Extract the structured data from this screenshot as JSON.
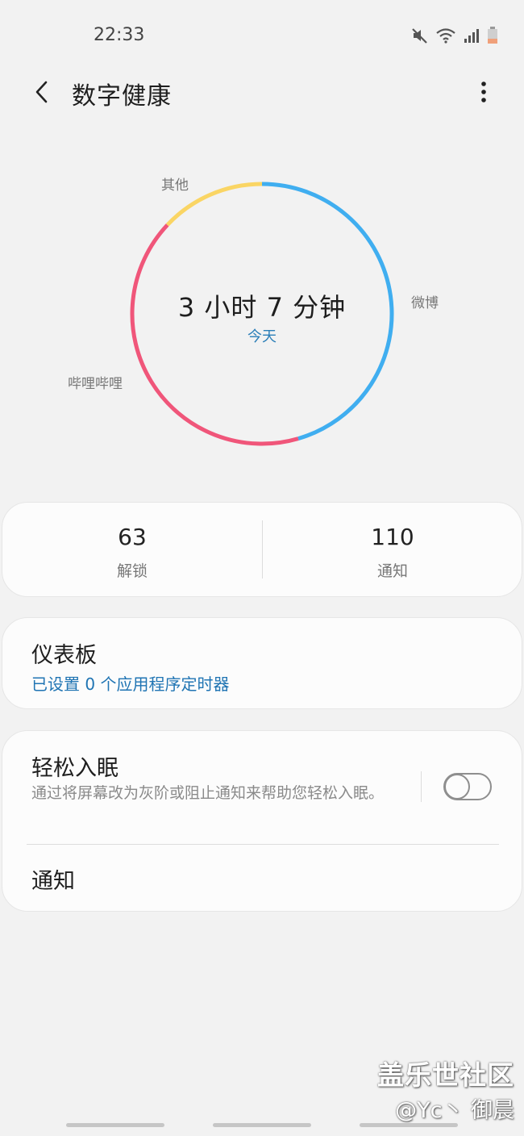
{
  "status_bar": {
    "time": "22:33",
    "icons": [
      "mute-icon",
      "wifi-icon",
      "signal-icon",
      "battery-icon"
    ]
  },
  "app_bar": {
    "title": "数字健康",
    "back_icon": "chevron-left-icon",
    "more_icon": "more-vertical-icon"
  },
  "chart_data": {
    "type": "pie",
    "total_label": "3 小时 7 分钟",
    "period_label": "今天",
    "slices": [
      {
        "label": "微博",
        "fraction": 0.455,
        "color": "#40aef0"
      },
      {
        "label": "哔哩哔哩",
        "fraction": 0.415,
        "color": "#f0567a"
      },
      {
        "label": "其他",
        "fraction": 0.13,
        "color": "#fad564"
      }
    ]
  },
  "stats": {
    "unlocks_value": "63",
    "unlocks_label": "解锁",
    "notifications_value": "110",
    "notifications_label": "通知"
  },
  "dashboard": {
    "title": "仪表板",
    "subtitle": "已设置 0 个应用程序定时器"
  },
  "bedtime": {
    "title": "轻松入眠",
    "description": "通过将屏幕改为灰阶或阻止通知来帮助您轻松入眠。",
    "enabled": false
  },
  "notifications_row": {
    "title": "通知"
  },
  "watermark": {
    "brand": "盖乐世社区",
    "user": "@Yc丶 御晨"
  },
  "colors": {
    "accent_blue": "#1f74b3",
    "weibo": "#40aef0",
    "bilibili": "#f0567a",
    "other": "#fad564"
  }
}
